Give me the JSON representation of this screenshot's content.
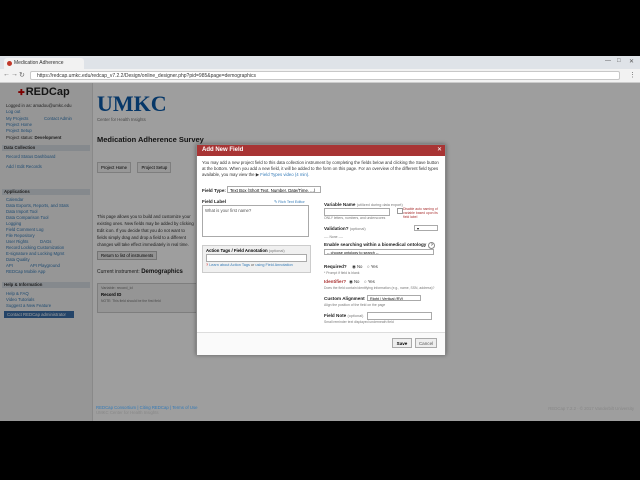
{
  "browser": {
    "tab_title": "Medication Adherence",
    "url": "https://redcap.umkc.edu/redcap_v7.2.2/Design/online_designer.php?pid=985&page=demographics"
  },
  "sidebar": {
    "logo": "REDCap",
    "user_lines": [
      "Logged in as: amadou@umkc.edu",
      "Log out"
    ],
    "links": [
      "My Projects",
      "Contact Admin",
      "Project Home",
      "Project Setup"
    ],
    "project_status_label": "Project status:",
    "project_status_value": "Development",
    "data_collection_head": "Data Collection",
    "data_collection_items": [
      "Record Status Dashboard",
      "Add / Edit Records"
    ],
    "applications_head": "Applications",
    "applications_items": [
      "Calendar",
      "Data Exports, Reports, and Stats",
      "Data Import Tool",
      "Data Comparison Tool",
      "Logging",
      "Field Comment Log",
      "File Repository",
      "User Rights",
      "DAGs",
      "Record Locking Customization",
      "E-signature and Locking Mgmt",
      "Data Quality",
      "API",
      "API Playground",
      "REDCap Mobile App"
    ],
    "help_head": "Help & Information",
    "help_items": [
      "Help & FAQ",
      "Video Tutorials",
      "Suggest a New Feature"
    ],
    "contact_button": "Contact REDCap administrator"
  },
  "main": {
    "logo": "UMKC",
    "logo_sub": "Center for Health Insights",
    "project_title": "Medication Adherence Survey",
    "tabs": [
      "Project Home",
      "Project Setup"
    ],
    "body_lines": [
      "This page allows you to build and customize your",
      "existing ones. New fields may be added by clicking",
      "Edit icon. If you decide that you do not want to",
      "fields simply drag and drop a field to a different",
      "changes will take effect immediately in real time."
    ],
    "return_button": "Return to list of instruments",
    "current_instrument_label": "Current instrument:",
    "current_instrument_value": "Demographics",
    "field_box_lines": [
      "Variable: record_id",
      "Record ID",
      "NOTE: This field should be the first field"
    ],
    "footer_links": [
      "REDCap Consortium",
      "Citing REDCap",
      "Terms of Use"
    ],
    "footer_sub": "UMKC Center for Health Insights",
    "footer_right": "REDCap 7.2.2 · © 2017 Vanderbilt University"
  },
  "dialog": {
    "title": "Add New Field",
    "instructions": "You may add a new project field to this data collection instrument by completing the fields below and clicking the Save button at the bottom. When you add a new field, it will be added to the form on this page. For an overview of the different field types available, you may view the",
    "instructions_link": "Field Types video (4 min).",
    "field_type_label": "Field Type:",
    "field_type_value": "Text Box (Short Text, Number, Date/Time, ...)",
    "field_label_label": "Field Label",
    "rich_text_link": "Rich Text Editor",
    "field_label_value": "What is your first name?",
    "action_tags_label": "Action Tags / Field Annotation",
    "optional": "(optional)",
    "action_tags_learn": "Learn about Action Tags",
    "or_text": "or",
    "field_annotation_link": "using Field Annotation",
    "variable_name_label": "Variable Name",
    "variable_name_hint_inline": "(utilized during data export)",
    "variable_name_hint": "ONLY letters, numbers, and underscores",
    "auto_var_note": "Disable auto naming of variable based upon its field label",
    "validation_label": "Validation?",
    "validation_value": "---- None ----",
    "ontology_label": "Enable searching within a biomedical ontology",
    "ontology_value": "-- choose ontology to search --",
    "required_label": "Required?",
    "required_no": "No",
    "required_yes": "Yes",
    "required_hint": "* Prompt if field is blank",
    "identifier_label": "Identifier?",
    "identifier_no": "No",
    "identifier_yes": "Yes",
    "identifier_hint": "Does the field contain identifying information (e.g., name, SSN, address)?",
    "alignment_label": "Custom Alignment",
    "alignment_value": "Right / Vertical (RV)",
    "alignment_hint": "Align the position of the field on the page",
    "field_note_label": "Field Note",
    "field_note_hint": "Small reminder text displayed underneath field",
    "save_button": "Save",
    "cancel_button": "Cancel"
  }
}
